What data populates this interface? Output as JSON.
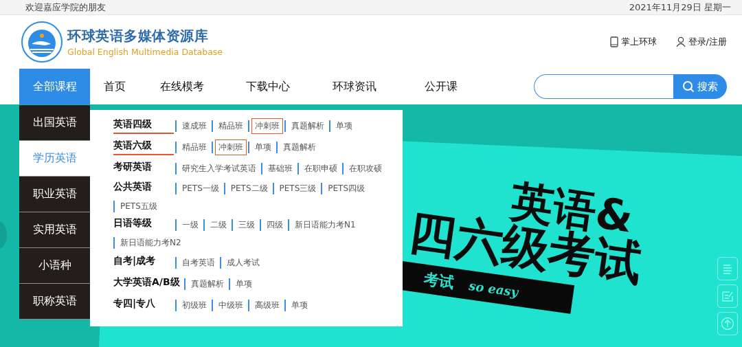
{
  "top_bar": {
    "welcome": "欢迎嘉应学院的朋友",
    "date": "2021年11月29日 星期一"
  },
  "header": {
    "title": "环球英语多媒体资源库",
    "subtitle": "Global English Multimedia Database",
    "links": [
      {
        "kind": "mobile",
        "label": "掌上环球"
      },
      {
        "kind": "user",
        "label": "登录/注册"
      }
    ]
  },
  "nav": {
    "all_courses": "全部课程",
    "items": [
      {
        "label": "首页",
        "selected": false
      },
      {
        "label": "在线模考",
        "selected": false
      },
      {
        "label": "下载中心",
        "selected": false
      },
      {
        "label": "环球资讯",
        "selected": false
      },
      {
        "label": "公开课",
        "selected": false
      }
    ],
    "search": {
      "button": "搜索"
    }
  },
  "sidebar": {
    "items": [
      {
        "label": "出国英语",
        "selected": false
      },
      {
        "label": "学历英语",
        "selected": true
      },
      {
        "label": "职业英语",
        "selected": false
      },
      {
        "label": "实用英语",
        "selected": false
      },
      {
        "label": "小语种",
        "selected": false
      },
      {
        "label": "职称英语",
        "selected": false
      }
    ]
  },
  "menu": {
    "groups": [
      {
        "category": "英语四级",
        "underlined": true,
        "links": [
          {
            "label": "速成班",
            "boxed": false
          },
          {
            "label": "精品班",
            "boxed": false
          },
          {
            "label": "冲刺班",
            "boxed": true
          },
          {
            "label": "真题解析",
            "boxed": false
          },
          {
            "label": "单项",
            "boxed": false
          }
        ]
      },
      {
        "category": "英语六级",
        "underlined": true,
        "links": [
          {
            "label": "精品班",
            "boxed": false
          },
          {
            "label": "冲刺班",
            "boxed": true
          },
          {
            "label": "单项",
            "boxed": false
          },
          {
            "label": "真题解析",
            "boxed": false
          }
        ]
      },
      {
        "category": "考研英语",
        "underlined": false,
        "links": [
          {
            "label": "研究生入学考试英语",
            "boxed": false
          },
          {
            "label": "基础班",
            "boxed": false
          },
          {
            "label": "在职申硕",
            "boxed": false
          },
          {
            "label": "在职攻硕",
            "boxed": false
          }
        ]
      },
      {
        "category": "公共英语",
        "underlined": false,
        "links": [
          {
            "label": "PETS一级",
            "boxed": false
          },
          {
            "label": "PETS二级",
            "boxed": false
          },
          {
            "label": "PETS三级",
            "boxed": false
          },
          {
            "label": "PETS四级",
            "boxed": false
          },
          {
            "label": "PETS五级",
            "boxed": false
          }
        ]
      },
      {
        "category": "日语等级",
        "underlined": false,
        "links": [
          {
            "label": "一级",
            "boxed": false
          },
          {
            "label": "二级",
            "boxed": false
          },
          {
            "label": "三级",
            "boxed": false
          },
          {
            "label": "四级",
            "boxed": false
          },
          {
            "label": "新日语能力考N1",
            "boxed": false
          },
          {
            "label": "新日语能力考N2",
            "boxed": false
          }
        ]
      },
      {
        "category": "自考|成考",
        "underlined": false,
        "links": [
          {
            "label": "自考英语",
            "boxed": false
          },
          {
            "label": "成人考试",
            "boxed": false
          }
        ]
      },
      {
        "category": "大学英语A/B级",
        "underlined": false,
        "links": [
          {
            "label": "真题解析",
            "boxed": false
          },
          {
            "label": "单项",
            "boxed": false
          }
        ]
      },
      {
        "category": "专四|专八",
        "underlined": false,
        "links": [
          {
            "label": "初级班",
            "boxed": false
          },
          {
            "label": "中级班",
            "boxed": false
          },
          {
            "label": "高级班",
            "boxed": false
          },
          {
            "label": "单项",
            "boxed": false
          }
        ]
      }
    ]
  },
  "banner": {
    "line_1": "英语&",
    "line_2": "四六级考试",
    "tag": "考试",
    "tag_slogan": "so easy"
  }
}
